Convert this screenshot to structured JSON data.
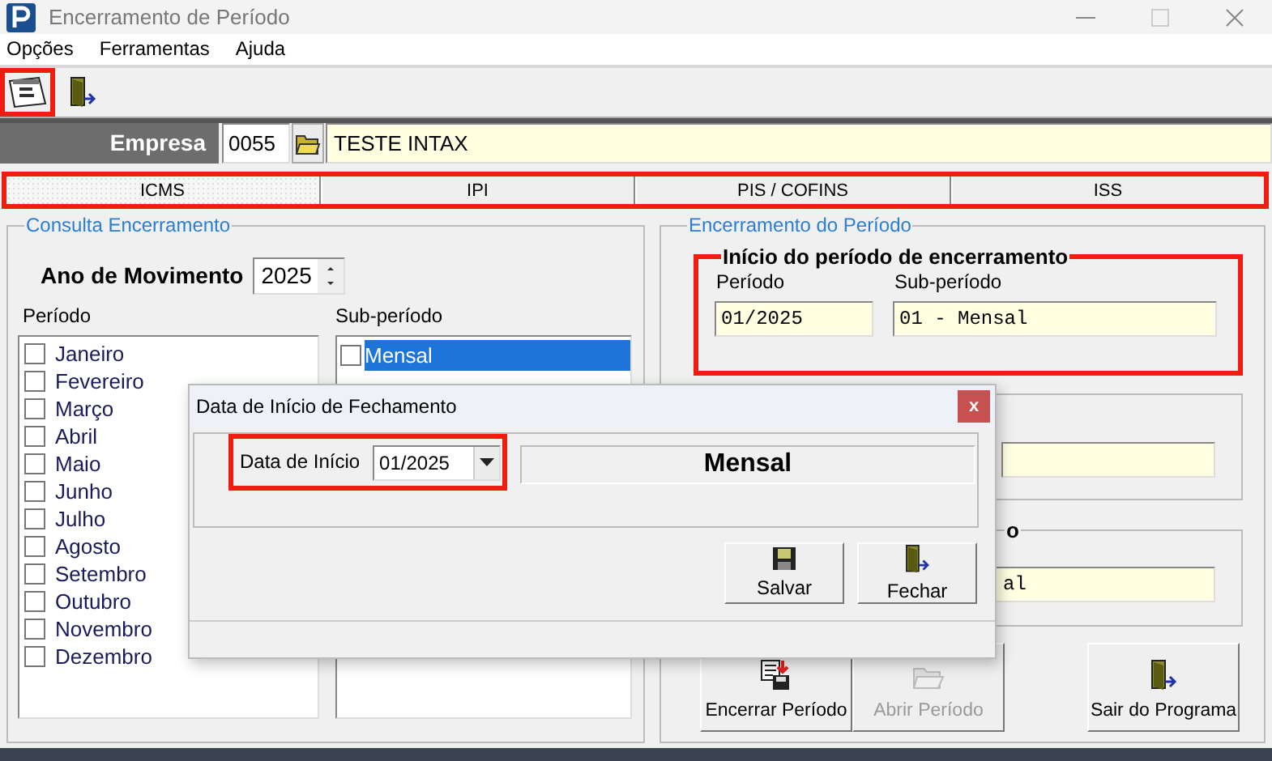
{
  "window": {
    "title": "Encerramento de Período"
  },
  "menu": [
    "Opções",
    "Ferramentas",
    "Ajuda"
  ],
  "toolbar": [
    {
      "kind": "calendar",
      "highlighted": true
    },
    {
      "kind": "exit",
      "highlighted": false
    }
  ],
  "company": {
    "label": "Empresa",
    "code": "0055",
    "name": "TESTE INTAX"
  },
  "tabs": {
    "highlighted": true,
    "items": [
      {
        "label": "ICMS",
        "selected": true
      },
      {
        "label": "IPI",
        "selected": false
      },
      {
        "label": "PIS / COFINS",
        "selected": false
      },
      {
        "label": "ISS",
        "selected": false
      }
    ]
  },
  "consulta": {
    "title": "Consulta Encerramento",
    "year_label": "Ano de Movimento",
    "year": "2025",
    "period_label": "Período",
    "subperiod_label": "Sub-período",
    "periods": [
      {
        "label": "Janeiro",
        "checked": false
      },
      {
        "label": "Fevereiro",
        "checked": false
      },
      {
        "label": "Março",
        "checked": false
      },
      {
        "label": "Abril",
        "checked": false
      },
      {
        "label": "Maio",
        "checked": false
      },
      {
        "label": "Junho",
        "checked": false
      },
      {
        "label": "Julho",
        "checked": false
      },
      {
        "label": "Agosto",
        "checked": false
      },
      {
        "label": "Setembro",
        "checked": false
      },
      {
        "label": "Outubro",
        "checked": false
      },
      {
        "label": "Novembro",
        "checked": false
      },
      {
        "label": "Dezembro",
        "checked": false
      }
    ],
    "subperiods": [
      {
        "label": "Mensal",
        "checked": false,
        "selected": true
      }
    ]
  },
  "encerramento": {
    "title": "Encerramento do Período",
    "start_group": {
      "title": "Início do período de encerramento",
      "highlighted": true,
      "period_label": "Período",
      "period": "01/2025",
      "subperiod_label": "Sub-período",
      "subperiod": "01 - Mensal"
    },
    "group_3": {
      "title": "o",
      "value": "al"
    },
    "buttons": [
      {
        "label": "Encerrar Período",
        "kind": "close_period",
        "disabled": false
      },
      {
        "label": "Abrir Período",
        "kind": "open_period",
        "disabled": true
      },
      {
        "label": "Sair do Programa",
        "kind": "exit",
        "disabled": false
      }
    ]
  },
  "dialog": {
    "title": "Data de Início de Fechamento",
    "close": "x",
    "date_label": "Data de Início",
    "date": "01/2025",
    "highlighted": true,
    "subperiod": "Mensal",
    "buttons": [
      {
        "label": "Salvar",
        "kind": "save"
      },
      {
        "label": "Fechar",
        "kind": "exit"
      }
    ]
  }
}
